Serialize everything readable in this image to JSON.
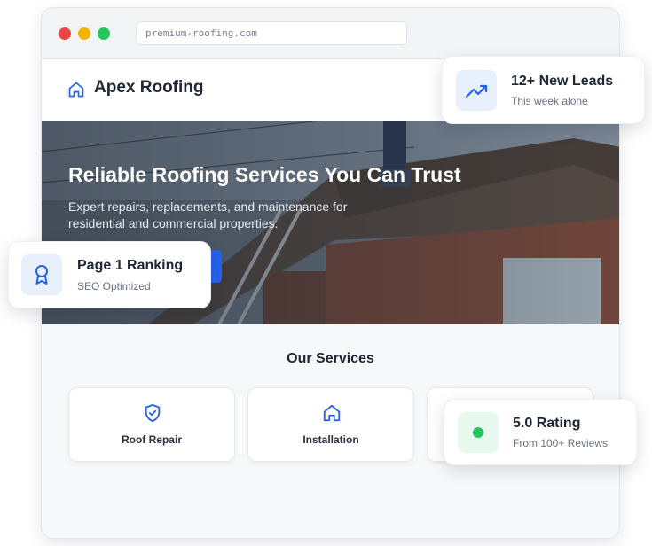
{
  "browser": {
    "url": "premium-roofing.com"
  },
  "site": {
    "brand": "Apex Roofing",
    "brand_icon": "home-icon"
  },
  "hero": {
    "title": "Reliable Roofing Services You Can Trust",
    "subtitle": "Expert repairs, replacements, and maintenance for residential and commercial properties."
  },
  "services": {
    "heading": "Our Services",
    "items": [
      {
        "label": "Roof Repair",
        "icon": "shield-check-icon"
      },
      {
        "label": "Installation",
        "icon": "home-icon"
      },
      {
        "label": "",
        "icon": ""
      }
    ]
  },
  "badges": {
    "leads": {
      "title": "12+ New Leads",
      "subtitle": "This week alone",
      "icon": "trending-up-icon"
    },
    "ranking": {
      "title": "Page 1 Ranking",
      "subtitle": "SEO Optimized",
      "icon": "award-icon"
    },
    "rating": {
      "title": "5.0 Rating",
      "subtitle": "From 100+ Reviews",
      "icon": "status-dot"
    }
  },
  "colors": {
    "accent": "#2563eb",
    "success": "#22c55e",
    "window_close": "#ef4444",
    "window_minimize": "#f4b400",
    "window_maximize": "#22c55e"
  }
}
